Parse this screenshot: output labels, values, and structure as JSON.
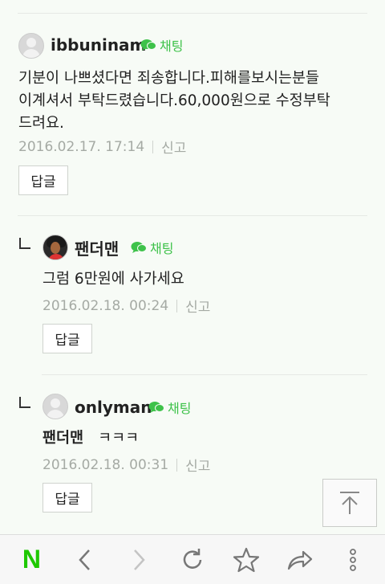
{
  "comments": [
    {
      "nickname": "ibbuninam",
      "chat_label": "채팅",
      "text_line1": "기분이 나쁘셨다면 죄송합니다.피해를보시는분들",
      "text_line2": "이계셔서 부탁드렸습니다.60,000원으로 수정부탁",
      "text_line3": "드려요.",
      "date": "2016.02.17. 17:14",
      "report_label": "신고",
      "reply_label": "답글"
    },
    {
      "nickname": "팬더맨",
      "chat_label": "채팅",
      "text": "그럼 6만원에 사가세요",
      "date": "2016.02.18. 00:24",
      "report_label": "신고",
      "reply_label": "답글"
    },
    {
      "nickname": "onlyman",
      "chat_label": "채팅",
      "mention": "팬더맨",
      "text": "ㅋㅋㅋ",
      "date": "2016.02.18. 00:31",
      "report_label": "신고",
      "reply_label": "답글"
    }
  ],
  "bottom_bar": {
    "brand_letter": "N",
    "brand_color": "#1ec800",
    "icons": [
      "back-icon",
      "forward-icon",
      "refresh-icon",
      "star-icon",
      "share-icon",
      "more-icon"
    ]
  },
  "accent_green": "#3ec24a"
}
